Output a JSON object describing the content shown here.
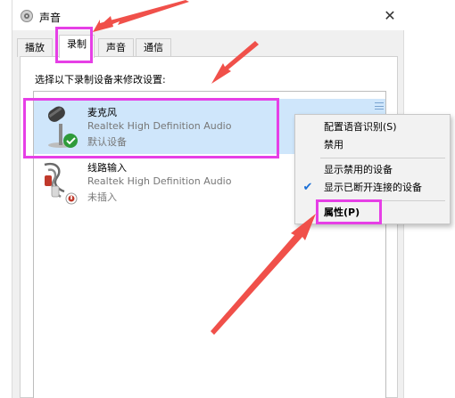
{
  "window": {
    "title": "声音",
    "close_glyph": "✕"
  },
  "tabs": [
    {
      "label": "播放",
      "active": false
    },
    {
      "label": "录制",
      "active": true
    },
    {
      "label": "声音",
      "active": false
    },
    {
      "label": "通信",
      "active": false
    }
  ],
  "panel": {
    "instruction": "选择以下录制设备来修改设置:"
  },
  "devices": [
    {
      "name": "麦克风",
      "driver": "Realtek High Definition Audio",
      "status": "默认设备",
      "icon": "microphone-icon",
      "badge": "default-check-icon",
      "selected": true
    },
    {
      "name": "线路输入",
      "driver": "Realtek High Definition Audio",
      "status": "未插入",
      "icon": "line-in-cable-icon",
      "badge": "unplugged-icon",
      "selected": false
    }
  ],
  "context_menu": {
    "items": [
      {
        "label": "配置语音识别(S)",
        "checked": false,
        "bold": false
      },
      {
        "label": "禁用",
        "checked": false,
        "bold": false
      },
      {
        "label": "显示禁用的设备",
        "checked": false,
        "bold": false
      },
      {
        "label": "显示已断开连接的设备",
        "checked": true,
        "bold": false
      },
      {
        "label": "属性(P)",
        "checked": false,
        "bold": true
      }
    ]
  },
  "colors": {
    "annotation_highlight": "#e63fe6",
    "annotation_arrow": "#f0504a",
    "selection": "#cfe6fb",
    "check_accent": "#1a6fd6"
  }
}
